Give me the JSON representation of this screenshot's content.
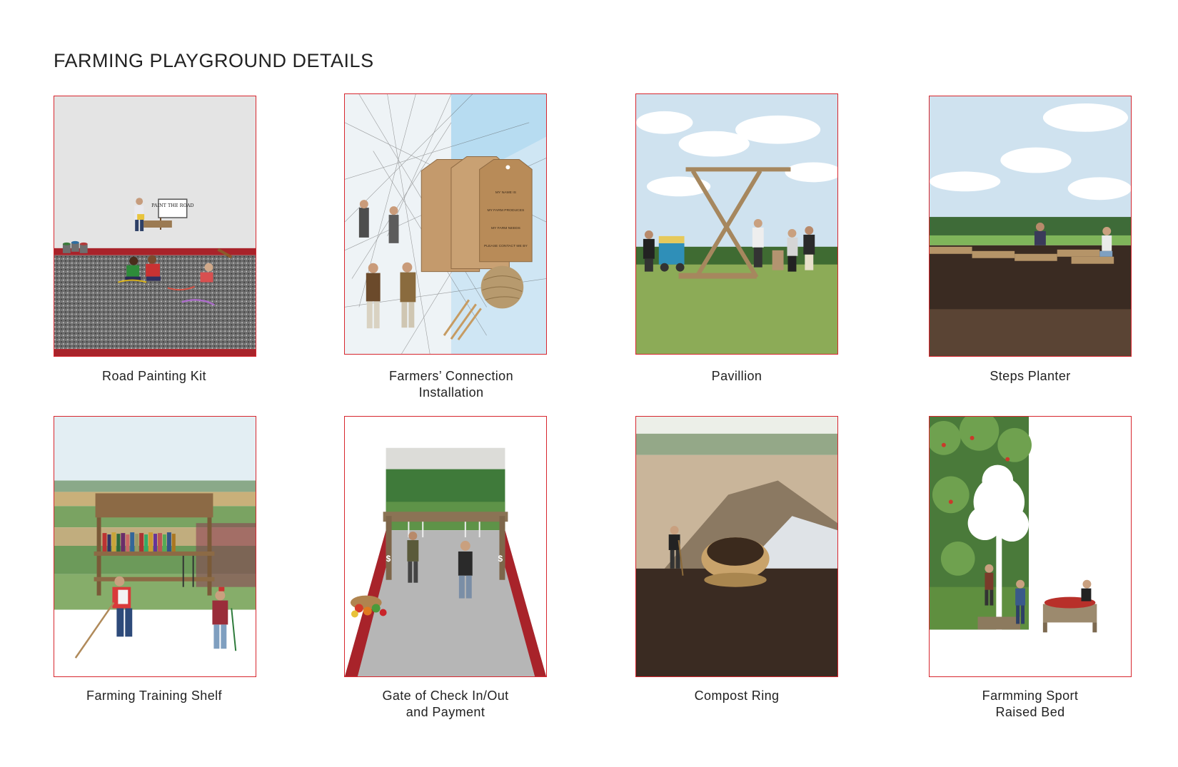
{
  "page": {
    "title": "FARMING PLAYGROUND DETAILS"
  },
  "panels": [
    {
      "caption": "Road Painting Kit",
      "sign_text": "PAINT THE ROAD"
    },
    {
      "caption": "Farmers’ Connection\nInstallation",
      "tag_lines": [
        "MY NAME IS",
        "MY FARM PRODUCES",
        "MY FARM NEEDS",
        "PLEASE CONTACT ME BY"
      ]
    },
    {
      "caption": "Pavillion"
    },
    {
      "caption": "Steps Planter"
    },
    {
      "caption": "Farming Training Shelf"
    },
    {
      "caption": "Gate of Check In/Out\nand Payment",
      "gate_sign": "$"
    },
    {
      "caption": "Compost Ring"
    },
    {
      "caption": "Farmming Sport\nRaised Bed"
    }
  ],
  "colors": {
    "frame": "#d7262e",
    "accent_red": "#a8232a",
    "sky": "#dbe8f2",
    "grass": "#7fa04f",
    "soil": "#3a2b22"
  }
}
